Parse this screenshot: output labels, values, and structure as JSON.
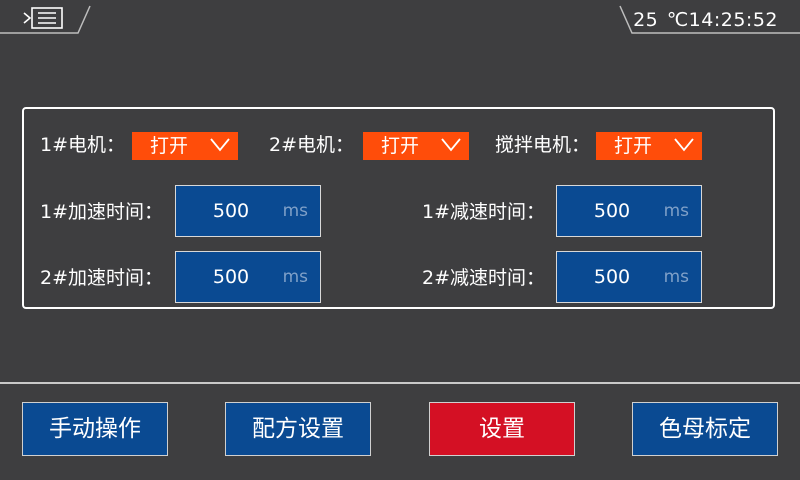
{
  "header": {
    "menu_icon": "menu-list-icon",
    "temperature": "25",
    "temperature_unit": "℃",
    "time": "14:25:52"
  },
  "motors": [
    {
      "label": "1#电机：",
      "value": "打开"
    },
    {
      "label": "2#电机：",
      "value": "打开"
    },
    {
      "label": "搅拌电机：",
      "value": "打开"
    }
  ],
  "timings": [
    {
      "label": "1#加速时间：",
      "value": "500",
      "unit": "ms"
    },
    {
      "label": "1#减速时间：",
      "value": "500",
      "unit": "ms"
    },
    {
      "label": "2#加速时间：",
      "value": "500",
      "unit": "ms"
    },
    {
      "label": "2#减速时间：",
      "value": "500",
      "unit": "ms"
    }
  ],
  "bottom_buttons": [
    {
      "label": "手动操作",
      "active": false
    },
    {
      "label": "配方设置",
      "active": false
    },
    {
      "label": "设置",
      "active": true
    },
    {
      "label": "色母标定",
      "active": false
    }
  ],
  "colors": {
    "background": "#3e3e40",
    "dropdown": "#ff4d0a",
    "field": "#0a4a92",
    "button": "#0a4a92",
    "active_button": "#d41024"
  }
}
